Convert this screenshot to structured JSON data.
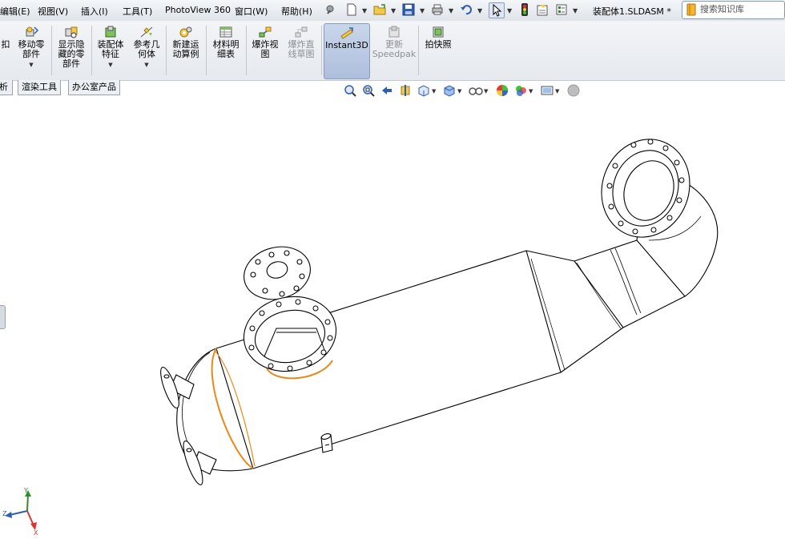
{
  "menubar": {
    "items": [
      "编辑(E)",
      "视图(V)",
      "插入(I)",
      "工具(T)",
      "PhotoView 360",
      "窗口(W)",
      "帮助(H)"
    ],
    "quick_access_icons": [
      "pin-icon",
      "new-document-icon",
      "open-folder-icon",
      "save-icon",
      "print-icon",
      "undo-icon",
      "select-cursor-icon",
      "traffic-light-icon",
      "file-properties-icon",
      "options-icon"
    ]
  },
  "document": {
    "title": "装配体1.SLDASM *"
  },
  "search": {
    "placeholder": "搜索知识库"
  },
  "ribbon": {
    "buttons": [
      {
        "name": "ribbon-button-partial",
        "label": "扣",
        "icon": "partial-icon"
      },
      {
        "name": "ribbon-button-move-component",
        "label": "移动零\n部件",
        "icon": "move-component-icon"
      },
      {
        "name": "ribbon-button-show-hide",
        "label": "显示隐\n藏的零\n部件",
        "icon": "show-hide-icon"
      },
      {
        "name": "ribbon-button-assembly-features",
        "label": "装配体\n特征",
        "icon": "assembly-feature-icon"
      },
      {
        "name": "ribbon-button-reference-geometry",
        "label": "参考几\n何体",
        "icon": "reference-geometry-icon"
      },
      {
        "name": "ribbon-button-new-motion-study",
        "label": "新建运\n动算例",
        "icon": "motion-study-icon"
      },
      {
        "name": "ribbon-button-bom",
        "label": "材料明\n细表",
        "icon": "bom-icon"
      },
      {
        "name": "ribbon-button-exploded-view",
        "label": "爆炸视\n图",
        "icon": "exploded-view-icon"
      },
      {
        "name": "ribbon-button-explode-line-sketch",
        "label": "爆炸直\n线草图",
        "icon": "explode-line-icon"
      },
      {
        "name": "ribbon-button-instant3d",
        "label": "Instant3D",
        "icon": "instant3d-icon"
      },
      {
        "name": "ribbon-button-update-speedpak",
        "label": "更新\nSpeedpak",
        "icon": "speedpak-icon"
      },
      {
        "name": "ribbon-button-snapshot",
        "label": "拍快照",
        "icon": "snapshot-icon"
      }
    ]
  },
  "command_tabs": [
    "析",
    "渲染工具",
    "办公室产品"
  ],
  "view_toolbar": {
    "icons": [
      "zoom-to-fit-icon",
      "zoom-to-area-icon",
      "previous-view-icon",
      "section-view-icon",
      "view-orientation-icon",
      "display-style-icon",
      "hide-show-items-icon",
      "edit-appearance-icon",
      "apply-scene-icon",
      "view-settings-icon",
      "realview-icon"
    ]
  },
  "triad": {
    "x_label": "X",
    "y_label": "Y",
    "z_label": "Z"
  },
  "colors": {
    "highlight": "#e8891a",
    "ribbon_active": "#aebfdd",
    "model_line": "#000000"
  }
}
